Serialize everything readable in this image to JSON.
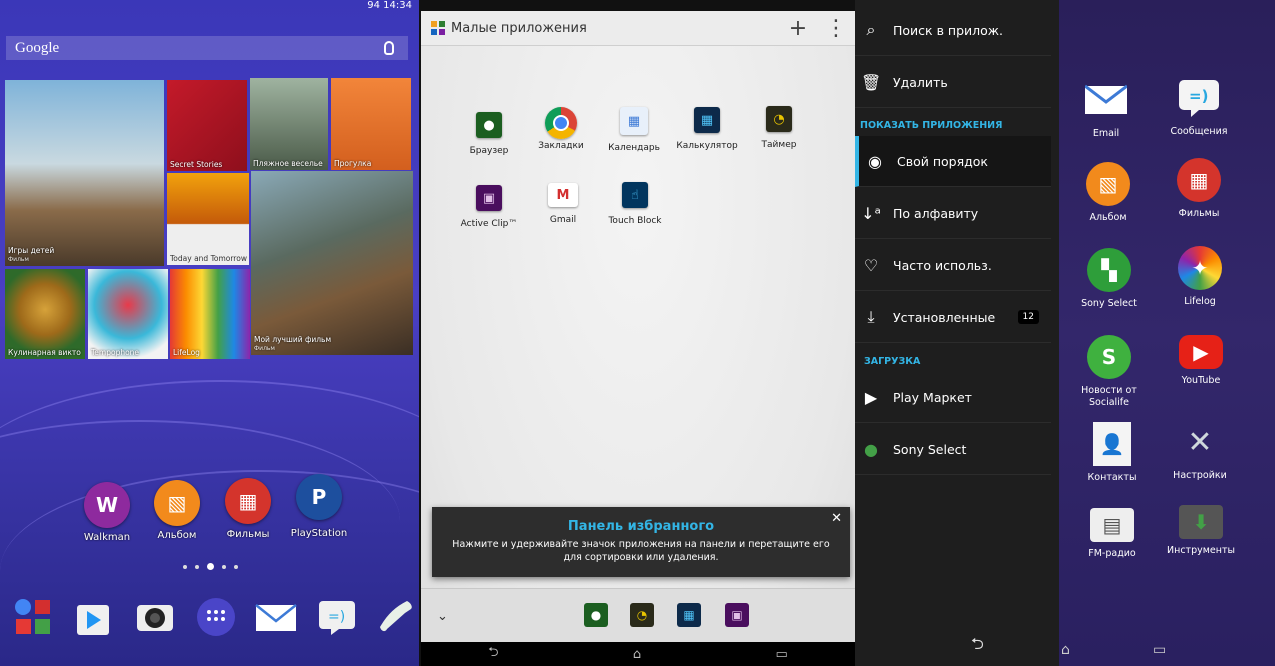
{
  "home": {
    "status_time": "14:34",
    "status_battery": "94",
    "search_label": "Google",
    "tiles": [
      {
        "title": "Игры детей",
        "subtitle": "Фильм"
      },
      {
        "title": "Secret Stories",
        "subtitle": ""
      },
      {
        "title": "Пляжное веселье",
        "subtitle": ""
      },
      {
        "title": "Прогулка",
        "subtitle": ""
      },
      {
        "title": "Today and Tomorrow",
        "subtitle": ""
      },
      {
        "title": "Мой лучший фильм",
        "subtitle": "Фильм"
      },
      {
        "title": "Кулинарная викто",
        "subtitle": ""
      },
      {
        "title": "Temрophone",
        "subtitle": ""
      },
      {
        "title": "LifeLog",
        "subtitle": ""
      }
    ],
    "apps": [
      {
        "label": "Walkman",
        "icon": "walkman-icon",
        "color": "#8e2a9e"
      },
      {
        "label": "Альбом",
        "icon": "album-icon",
        "color": "#f28a1c"
      },
      {
        "label": "Фильмы",
        "icon": "movies-icon",
        "color": "#d4342c"
      },
      {
        "label": "PlayStation",
        "icon": "playstation-icon",
        "color": "#1d4f9e"
      }
    ],
    "page_indicator": {
      "pages": 5,
      "current": 3
    },
    "dock": [
      "google-apps-folder-icon",
      "play-store-icon",
      "camera-icon",
      "app-drawer-icon",
      "email-icon",
      "messaging-icon",
      "phone-icon"
    ]
  },
  "small_apps": {
    "title": "Малые приложения",
    "add_label": "+",
    "menu_label": "⋮",
    "apps": [
      {
        "label": "Браузер",
        "icon": "browser-icon",
        "color": "#2e7d32"
      },
      {
        "label": "Закладки",
        "icon": "chrome-icon",
        "color": "#4285f4"
      },
      {
        "label": "Календарь",
        "icon": "calendar-icon",
        "color": "#90caf9"
      },
      {
        "label": "Калькулятор",
        "icon": "calculator-icon",
        "color": "#1565c0"
      },
      {
        "label": "Таймер",
        "icon": "timer-icon",
        "color": "#c9a400"
      },
      {
        "label": "Active Clip™",
        "icon": "active-clip-icon",
        "color": "#7b1fa2"
      },
      {
        "label": "Gmail",
        "icon": "gmail-icon",
        "color": "#d32f2f"
      },
      {
        "label": "Touch Block",
        "icon": "touch-block-icon",
        "color": "#0277bd"
      }
    ],
    "toast_title": "Панель избранного",
    "toast_body": "Нажмите и удерживайте значок приложения на панели и перетащите его для сортировки или удаления.",
    "toast_close": "✕",
    "favorites": [
      "browser-icon",
      "timer-icon",
      "calculator-icon",
      "active-clip-icon"
    ]
  },
  "drawer_menu": {
    "search": "Поиск в прилож.",
    "delete": "Удалить",
    "show_apps_header": "ПОКАЗАТЬ ПРИЛОЖЕНИЯ",
    "sort_items": [
      {
        "label": "Свой порядок",
        "icon": "custom-order-icon",
        "selected": true
      },
      {
        "label": "По алфавиту",
        "icon": "alphabetical-icon",
        "selected": false
      },
      {
        "label": "Часто использ.",
        "icon": "heart-icon",
        "selected": false
      },
      {
        "label": "Установленные",
        "icon": "download-icon",
        "selected": false,
        "badge": "12"
      }
    ],
    "download_header": "ЗАГРУЗКА",
    "download_items": [
      {
        "label": "Play Маркет",
        "icon": "play-market-icon"
      },
      {
        "label": "Sony Select",
        "icon": "sony-select-icon"
      }
    ]
  },
  "app_grid": {
    "apps": [
      {
        "label": "Email",
        "icon": "email-icon",
        "color": "#ffffff"
      },
      {
        "label": "Сообщения",
        "icon": "messages-icon",
        "color": "#29a8e0"
      },
      {
        "label": "Альбом",
        "icon": "album-icon",
        "color": "#f28a1c"
      },
      {
        "label": "Фильмы",
        "icon": "movies-icon",
        "color": "#d4342c"
      },
      {
        "label": "Sony Select",
        "icon": "sony-select-icon",
        "color": "#2e9e3a"
      },
      {
        "label": "Lifelog",
        "icon": "lifelog-icon",
        "color": "#8bc34a"
      },
      {
        "label": "Новости от Socialife",
        "icon": "socialife-icon",
        "color": "#3fb13f"
      },
      {
        "label": "YouTube",
        "icon": "youtube-icon",
        "color": "#e62117"
      },
      {
        "label": "Контакты",
        "icon": "contacts-icon",
        "color": "#e53935"
      },
      {
        "label": "Настройки",
        "icon": "settings-icon",
        "color": "#cfd8dc"
      },
      {
        "label": "FM-радио",
        "icon": "fm-radio-icon",
        "color": "#eeeeee"
      },
      {
        "label": "Инструменты",
        "icon": "tools-icon",
        "color": "#43a047"
      }
    ]
  }
}
